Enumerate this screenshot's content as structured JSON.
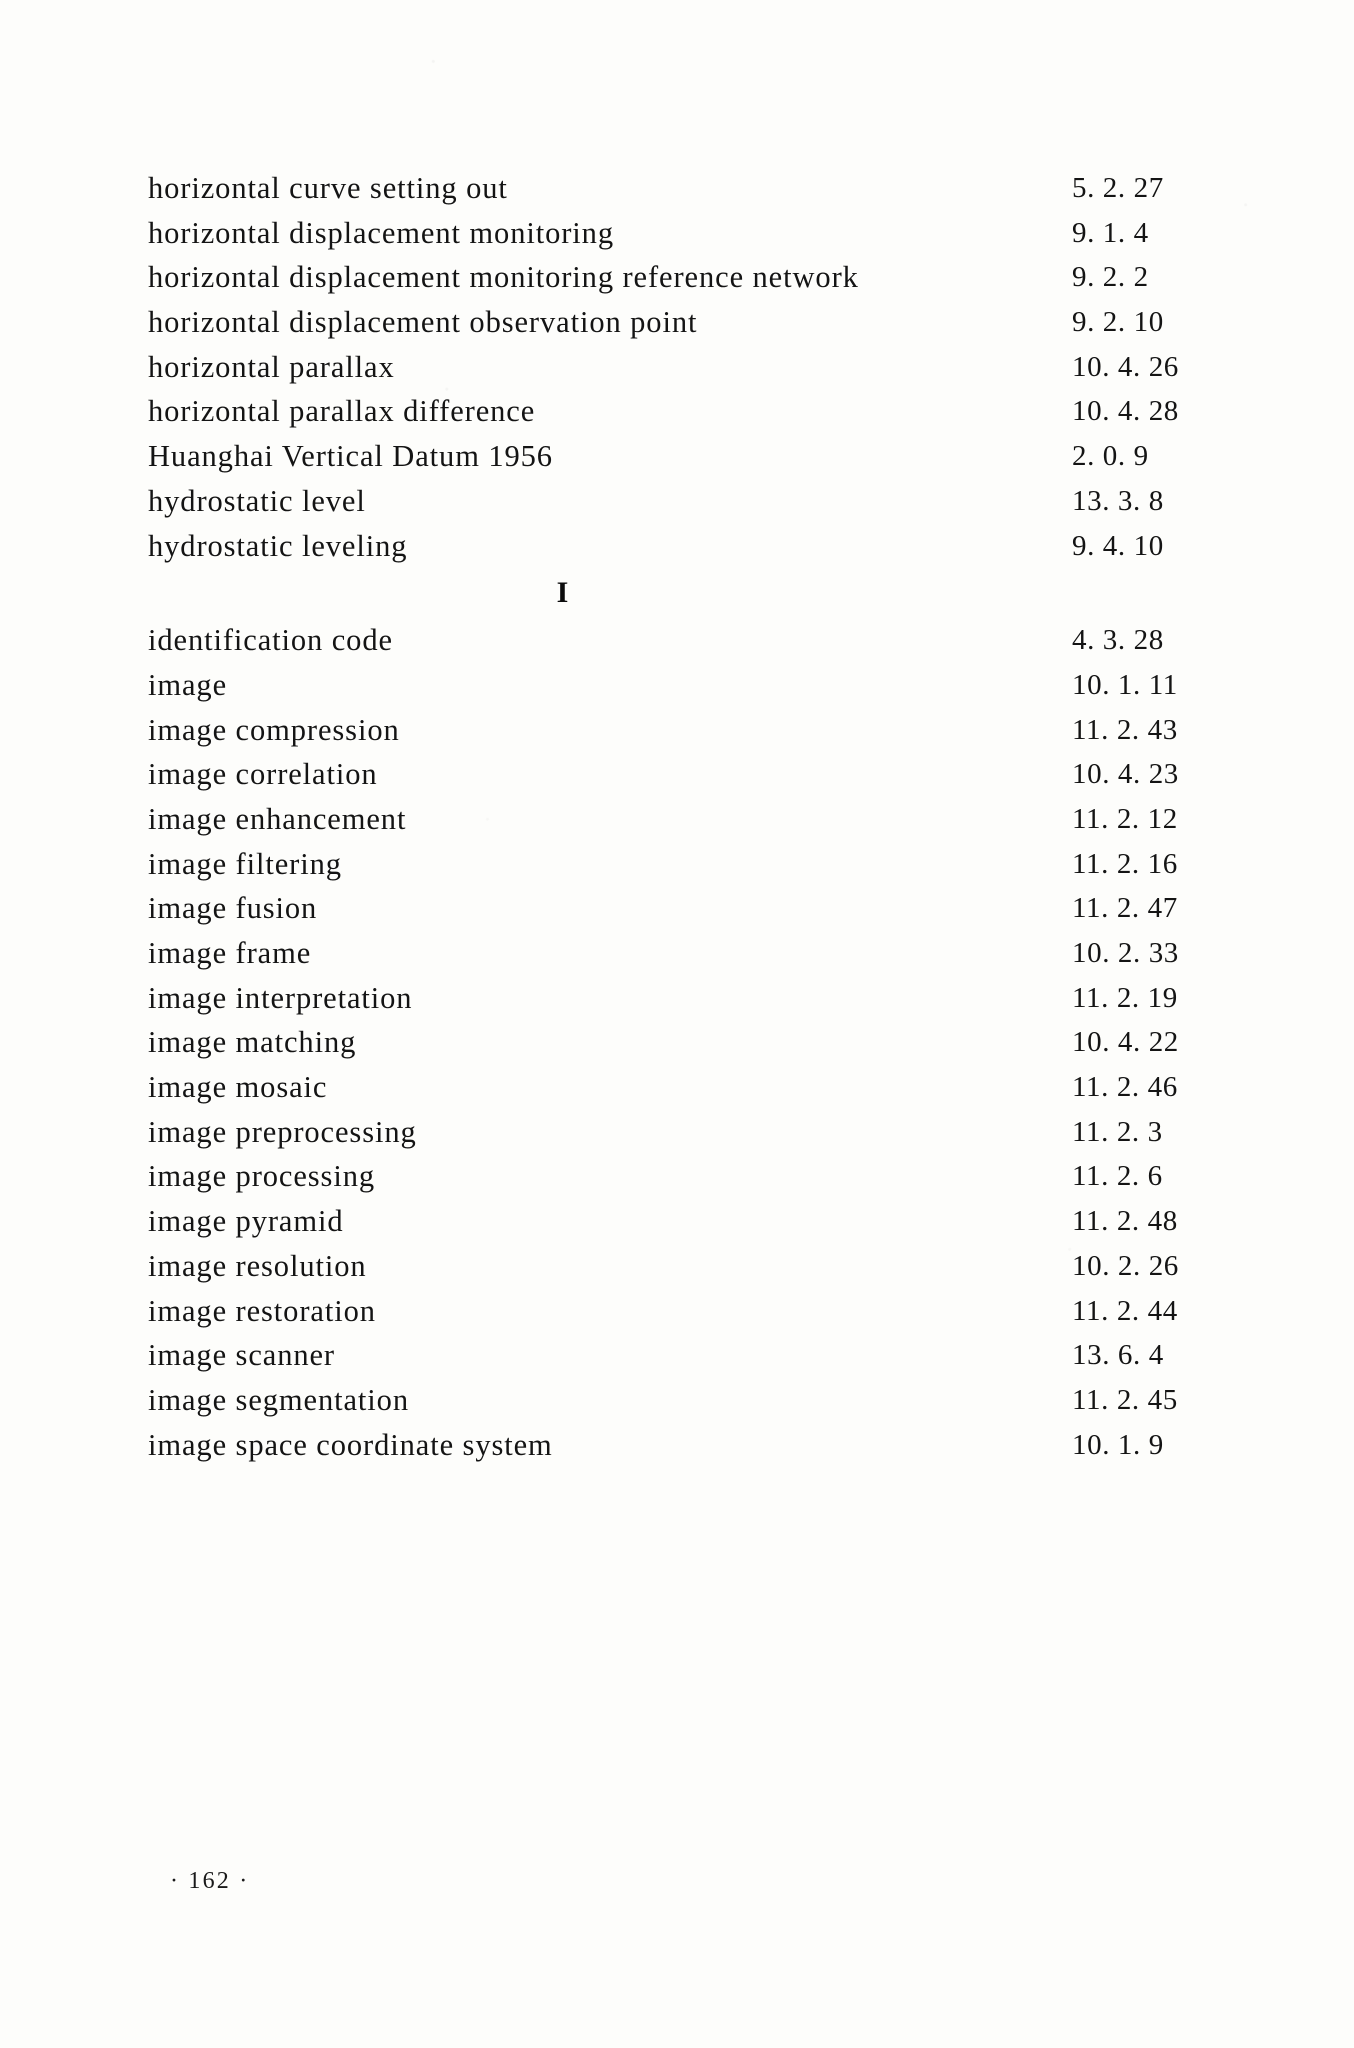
{
  "page": {
    "folio": "· 162 ·",
    "section_letter": "I"
  },
  "entries_before_section": [
    {
      "term": "horizontal curve setting out",
      "locator": "5. 2. 27"
    },
    {
      "term": "horizontal displacement monitoring",
      "locator": "9. 1. 4"
    },
    {
      "term": "horizontal displacement monitoring reference network",
      "locator": "9. 2. 2"
    },
    {
      "term": "horizontal displacement observation point",
      "locator": "9. 2. 10"
    },
    {
      "term": "horizontal parallax",
      "locator": "10. 4. 26"
    },
    {
      "term": "horizontal parallax difference",
      "locator": "10. 4. 28"
    },
    {
      "term": "Huanghai Vertical Datum 1956",
      "locator": "2. 0. 9"
    },
    {
      "term": "hydrostatic level",
      "locator": "13. 3. 8"
    },
    {
      "term": "hydrostatic leveling",
      "locator": "9. 4. 10"
    }
  ],
  "entries_after_section": [
    {
      "term": "identification code",
      "locator": "4. 3. 28"
    },
    {
      "term": "image",
      "locator": "10. 1. 11"
    },
    {
      "term": "image compression",
      "locator": "11. 2. 43"
    },
    {
      "term": "image correlation",
      "locator": "10. 4. 23"
    },
    {
      "term": "image enhancement",
      "locator": "11. 2. 12"
    },
    {
      "term": "image filtering",
      "locator": "11. 2. 16"
    },
    {
      "term": "image fusion",
      "locator": "11. 2. 47"
    },
    {
      "term": "image frame",
      "locator": "10. 2. 33"
    },
    {
      "term": "image interpretation",
      "locator": "11. 2. 19"
    },
    {
      "term": "image matching",
      "locator": "10. 4. 22"
    },
    {
      "term": "image mosaic",
      "locator": "11. 2. 46"
    },
    {
      "term": "image preprocessing",
      "locator": "11. 2. 3"
    },
    {
      "term": "image processing",
      "locator": "11. 2. 6"
    },
    {
      "term": "image pyramid",
      "locator": "11. 2. 48"
    },
    {
      "term": "image resolution",
      "locator": "10. 2. 26"
    },
    {
      "term": "image restoration",
      "locator": "11. 2. 44"
    },
    {
      "term": "image scanner",
      "locator": "13. 6. 4"
    },
    {
      "term": "image segmentation",
      "locator": "11. 2. 45"
    },
    {
      "term": "image space coordinate system",
      "locator": "10. 1. 9"
    }
  ]
}
